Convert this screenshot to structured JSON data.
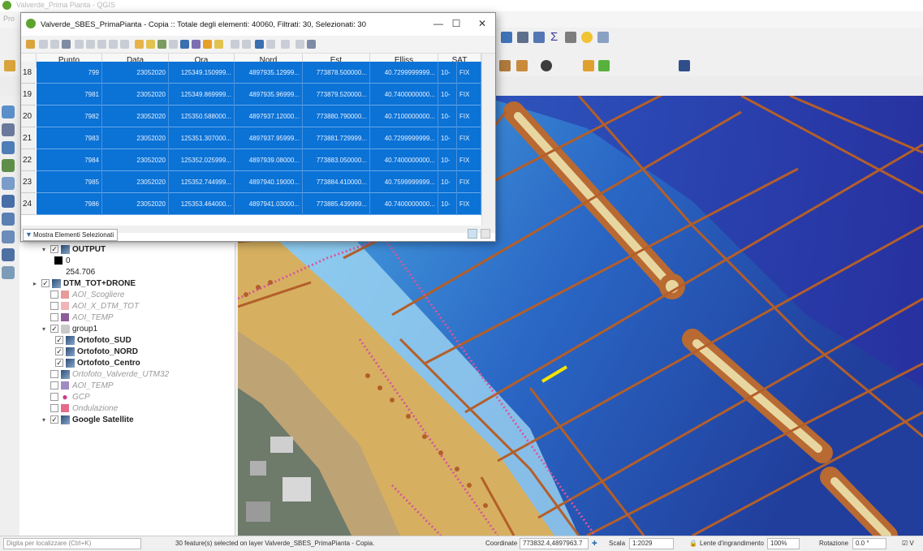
{
  "main_window": {
    "title": "Valverde_Prima Pianta - QGIS",
    "menu_first": "Pro"
  },
  "attribute_table": {
    "title": "Valverde_SBES_PrimaPianta - Copia :: Totale degli elementi: 40060, Filtrati: 30, Selezionati: 30",
    "window_buttons": {
      "minimize": "—",
      "maximize": "☐",
      "close": "✕"
    },
    "columns": [
      "Punto",
      "Data",
      "Ora",
      "Nord",
      "Est",
      "Elliss",
      "SAT"
    ],
    "rows": [
      {
        "id": "18",
        "cells": [
          "799",
          "23052020",
          "125349.150999...",
          "4897935.12999...",
          "773878.500000...",
          "40.7299999999...",
          "10-",
          "FIX"
        ]
      },
      {
        "id": "19",
        "cells": [
          "7981",
          "23052020",
          "125349.869999...",
          "4897935.96999...",
          "773879.520000...",
          "40.7400000000...",
          "10-",
          "FIX"
        ]
      },
      {
        "id": "20",
        "cells": [
          "7982",
          "23052020",
          "125350.588000...",
          "4897937.12000...",
          "773880.790000...",
          "40.7100000000...",
          "10-",
          "FIX"
        ]
      },
      {
        "id": "21",
        "cells": [
          "7983",
          "23052020",
          "125351.307000...",
          "4897937.95999...",
          "773881.729999...",
          "40.7299999999...",
          "10-",
          "FIX"
        ]
      },
      {
        "id": "22",
        "cells": [
          "7984",
          "23052020",
          "125352.025999...",
          "4897939.08000...",
          "773883.050000...",
          "40.7400000000...",
          "10-",
          "FIX"
        ]
      },
      {
        "id": "23",
        "cells": [
          "7985",
          "23052020",
          "125352.744999...",
          "4897940.19000...",
          "773884.410000...",
          "40.7599999999...",
          "10-",
          "FIX"
        ]
      },
      {
        "id": "24",
        "cells": [
          "7986",
          "23052020",
          "125353.464000...",
          "4897941.03000...",
          "773885.439999...",
          "40.7400000000...",
          "10-",
          "FIX"
        ]
      }
    ],
    "filter_button": "Mostra Elementi Selezionati"
  },
  "layers": {
    "raster_min": "0",
    "raster_max": "254.706",
    "items": [
      {
        "name": "OUTPUT",
        "checked": true,
        "bold": true,
        "kind": "raster"
      },
      {
        "name": "DTM_TOT+DRONE",
        "checked": true,
        "bold": true,
        "kind": "raster"
      },
      {
        "name": "AOI_Scogliere",
        "checked": false,
        "kind": "poly",
        "color": "#e79a9a"
      },
      {
        "name": "AOI_X_DTM_TOT",
        "checked": false,
        "kind": "poly",
        "color": "#f2b5b5"
      },
      {
        "name": "AOI_TEMP",
        "checked": false,
        "kind": "poly",
        "color": "#8e5b9a"
      },
      {
        "name": "group1",
        "checked": true,
        "kind": "group"
      },
      {
        "name": "Ortofoto_SUD",
        "checked": true,
        "bold": true,
        "kind": "raster"
      },
      {
        "name": "Ortofoto_NORD",
        "checked": true,
        "bold": true,
        "kind": "raster"
      },
      {
        "name": "Ortofoto_Centro",
        "checked": true,
        "bold": true,
        "kind": "raster"
      },
      {
        "name": "Ortofoto_Valverde_UTM32",
        "checked": false,
        "kind": "raster"
      },
      {
        "name": "AOI_TEMP",
        "checked": false,
        "kind": "poly",
        "color": "#9f8ac4"
      },
      {
        "name": "GCP",
        "checked": false,
        "kind": "point",
        "color": "#cf3a8a"
      },
      {
        "name": "Ondulazione",
        "checked": false,
        "kind": "poly",
        "color": "#e66a8a"
      },
      {
        "name": "Google Satellite",
        "checked": true,
        "bold": true,
        "kind": "raster"
      }
    ]
  },
  "statusbar": {
    "locator_placeholder": "Digita per localizzare (Ctrl+K)",
    "message": "30 feature(s) selected on layer Valverde_SBES_PrimaPianta - Copia.",
    "coord_label": "Coordinate",
    "coord_value": "773832.4,4897963.7",
    "scale_label": "Scala",
    "scale_value": "1:2029",
    "magnifier_label": "Lente d'ingrandimento",
    "magnifier_value": "100%",
    "rotation_label": "Rotazione",
    "rotation_value": "0.0 °"
  }
}
